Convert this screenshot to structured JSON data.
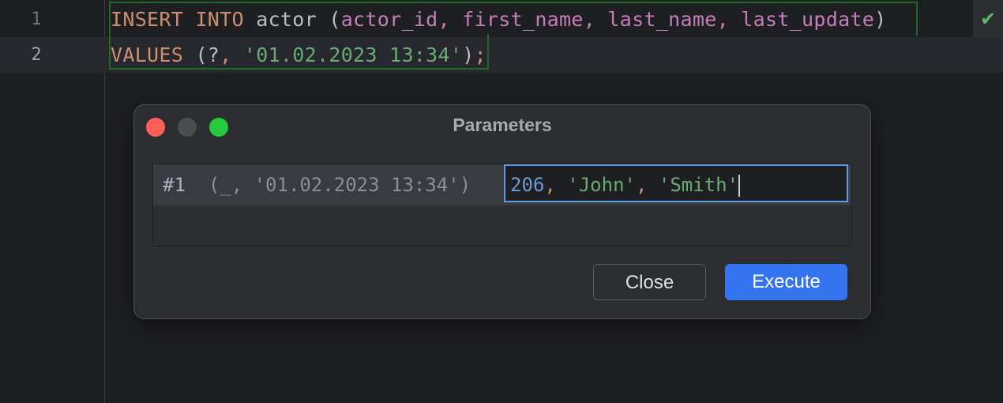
{
  "editor": {
    "lines": [
      {
        "number": "1",
        "tokens": {
          "kw1": "INSERT INTO",
          "table": "actor",
          "open": " (",
          "cols": "actor_id, first_name, last_name, last_update",
          "close": ")"
        }
      },
      {
        "number": "2",
        "tokens": {
          "kw": "VALUES",
          "open": " (?",
          "comma": ",",
          "str": "'01.02.2023 13:34'",
          "close": ")",
          "semi": ";"
        }
      }
    ],
    "status_icon": "check-icon"
  },
  "dialog": {
    "title": "Parameters",
    "row": {
      "index": "#1",
      "context": "(_, '01.02.2023 13:34')",
      "value_num": "206",
      "value_sep1": ", ",
      "value_s1": "'John'",
      "value_sep2": ", ",
      "value_s2": "'Smith'"
    },
    "close_label": "Close",
    "execute_label": "Execute"
  },
  "colors": {
    "accent": "#3574f0",
    "keyword": "#cf8e6d",
    "string": "#6aab73"
  }
}
